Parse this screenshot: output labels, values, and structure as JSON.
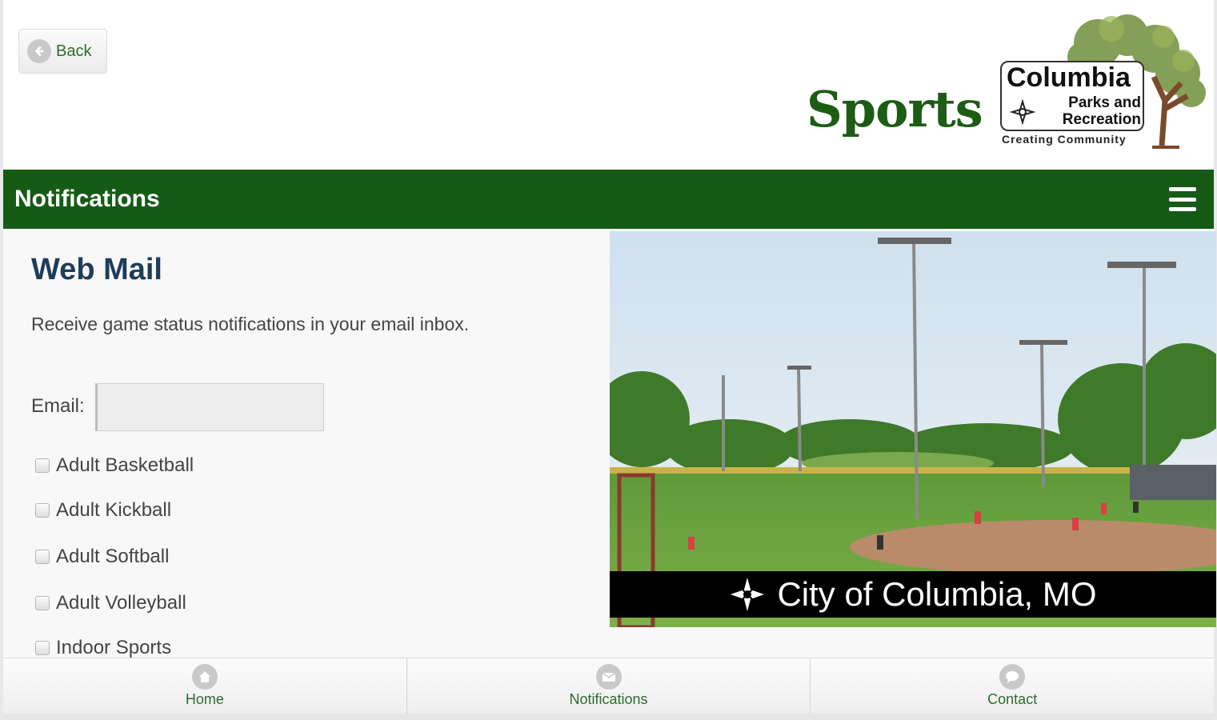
{
  "header": {
    "back_label": "Back",
    "page_title": "Sports",
    "logo": {
      "line1": "Columbia",
      "line2": "Parks and",
      "line3": "Recreation",
      "tagline": "Creating Community"
    }
  },
  "navbar": {
    "title": "Notifications"
  },
  "main": {
    "heading": "Web Mail",
    "description": "Receive game status notifications in your email inbox.",
    "email_label": "Email:",
    "email_value": "",
    "sports": [
      {
        "label": "Adult Basketball",
        "checked": false
      },
      {
        "label": "Adult Kickball",
        "checked": false
      },
      {
        "label": "Adult Softball",
        "checked": false
      },
      {
        "label": "Adult Volleyball",
        "checked": false
      },
      {
        "label": "Indoor Sports",
        "checked": false
      }
    ],
    "photo_caption": "City of Columbia, MO"
  },
  "footer": {
    "tabs": [
      {
        "label": "Home",
        "icon": "home-icon"
      },
      {
        "label": "Notifications",
        "icon": "mail-icon"
      },
      {
        "label": "Contact",
        "icon": "chat-icon"
      }
    ]
  },
  "colors": {
    "brand_green": "#155b15",
    "title_green": "#1d5c14",
    "heading_navy": "#1e3d59"
  }
}
